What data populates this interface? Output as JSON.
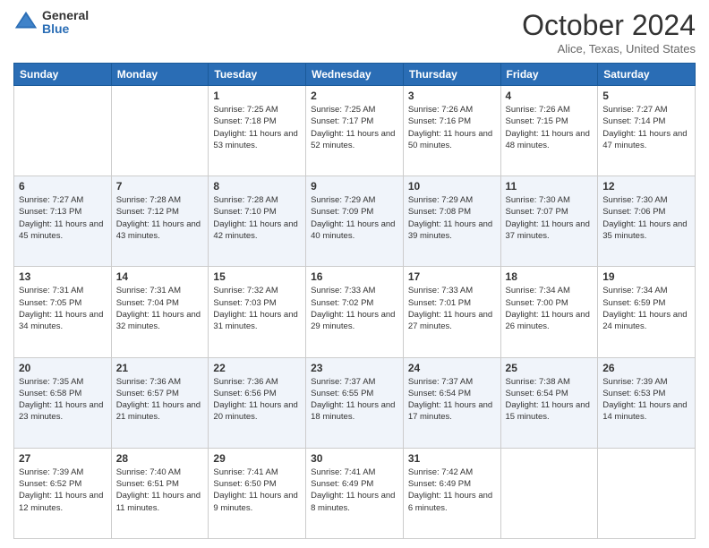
{
  "header": {
    "logo_general": "General",
    "logo_blue": "Blue",
    "month_title": "October 2024",
    "location": "Alice, Texas, United States"
  },
  "days_of_week": [
    "Sunday",
    "Monday",
    "Tuesday",
    "Wednesday",
    "Thursday",
    "Friday",
    "Saturday"
  ],
  "weeks": [
    [
      {
        "day": "",
        "sunrise": "",
        "sunset": "",
        "daylight": ""
      },
      {
        "day": "",
        "sunrise": "",
        "sunset": "",
        "daylight": ""
      },
      {
        "day": "1",
        "sunrise": "Sunrise: 7:25 AM",
        "sunset": "Sunset: 7:18 PM",
        "daylight": "Daylight: 11 hours and 53 minutes."
      },
      {
        "day": "2",
        "sunrise": "Sunrise: 7:25 AM",
        "sunset": "Sunset: 7:17 PM",
        "daylight": "Daylight: 11 hours and 52 minutes."
      },
      {
        "day": "3",
        "sunrise": "Sunrise: 7:26 AM",
        "sunset": "Sunset: 7:16 PM",
        "daylight": "Daylight: 11 hours and 50 minutes."
      },
      {
        "day": "4",
        "sunrise": "Sunrise: 7:26 AM",
        "sunset": "Sunset: 7:15 PM",
        "daylight": "Daylight: 11 hours and 48 minutes."
      },
      {
        "day": "5",
        "sunrise": "Sunrise: 7:27 AM",
        "sunset": "Sunset: 7:14 PM",
        "daylight": "Daylight: 11 hours and 47 minutes."
      }
    ],
    [
      {
        "day": "6",
        "sunrise": "Sunrise: 7:27 AM",
        "sunset": "Sunset: 7:13 PM",
        "daylight": "Daylight: 11 hours and 45 minutes."
      },
      {
        "day": "7",
        "sunrise": "Sunrise: 7:28 AM",
        "sunset": "Sunset: 7:12 PM",
        "daylight": "Daylight: 11 hours and 43 minutes."
      },
      {
        "day": "8",
        "sunrise": "Sunrise: 7:28 AM",
        "sunset": "Sunset: 7:10 PM",
        "daylight": "Daylight: 11 hours and 42 minutes."
      },
      {
        "day": "9",
        "sunrise": "Sunrise: 7:29 AM",
        "sunset": "Sunset: 7:09 PM",
        "daylight": "Daylight: 11 hours and 40 minutes."
      },
      {
        "day": "10",
        "sunrise": "Sunrise: 7:29 AM",
        "sunset": "Sunset: 7:08 PM",
        "daylight": "Daylight: 11 hours and 39 minutes."
      },
      {
        "day": "11",
        "sunrise": "Sunrise: 7:30 AM",
        "sunset": "Sunset: 7:07 PM",
        "daylight": "Daylight: 11 hours and 37 minutes."
      },
      {
        "day": "12",
        "sunrise": "Sunrise: 7:30 AM",
        "sunset": "Sunset: 7:06 PM",
        "daylight": "Daylight: 11 hours and 35 minutes."
      }
    ],
    [
      {
        "day": "13",
        "sunrise": "Sunrise: 7:31 AM",
        "sunset": "Sunset: 7:05 PM",
        "daylight": "Daylight: 11 hours and 34 minutes."
      },
      {
        "day": "14",
        "sunrise": "Sunrise: 7:31 AM",
        "sunset": "Sunset: 7:04 PM",
        "daylight": "Daylight: 11 hours and 32 minutes."
      },
      {
        "day": "15",
        "sunrise": "Sunrise: 7:32 AM",
        "sunset": "Sunset: 7:03 PM",
        "daylight": "Daylight: 11 hours and 31 minutes."
      },
      {
        "day": "16",
        "sunrise": "Sunrise: 7:33 AM",
        "sunset": "Sunset: 7:02 PM",
        "daylight": "Daylight: 11 hours and 29 minutes."
      },
      {
        "day": "17",
        "sunrise": "Sunrise: 7:33 AM",
        "sunset": "Sunset: 7:01 PM",
        "daylight": "Daylight: 11 hours and 27 minutes."
      },
      {
        "day": "18",
        "sunrise": "Sunrise: 7:34 AM",
        "sunset": "Sunset: 7:00 PM",
        "daylight": "Daylight: 11 hours and 26 minutes."
      },
      {
        "day": "19",
        "sunrise": "Sunrise: 7:34 AM",
        "sunset": "Sunset: 6:59 PM",
        "daylight": "Daylight: 11 hours and 24 minutes."
      }
    ],
    [
      {
        "day": "20",
        "sunrise": "Sunrise: 7:35 AM",
        "sunset": "Sunset: 6:58 PM",
        "daylight": "Daylight: 11 hours and 23 minutes."
      },
      {
        "day": "21",
        "sunrise": "Sunrise: 7:36 AM",
        "sunset": "Sunset: 6:57 PM",
        "daylight": "Daylight: 11 hours and 21 minutes."
      },
      {
        "day": "22",
        "sunrise": "Sunrise: 7:36 AM",
        "sunset": "Sunset: 6:56 PM",
        "daylight": "Daylight: 11 hours and 20 minutes."
      },
      {
        "day": "23",
        "sunrise": "Sunrise: 7:37 AM",
        "sunset": "Sunset: 6:55 PM",
        "daylight": "Daylight: 11 hours and 18 minutes."
      },
      {
        "day": "24",
        "sunrise": "Sunrise: 7:37 AM",
        "sunset": "Sunset: 6:54 PM",
        "daylight": "Daylight: 11 hours and 17 minutes."
      },
      {
        "day": "25",
        "sunrise": "Sunrise: 7:38 AM",
        "sunset": "Sunset: 6:54 PM",
        "daylight": "Daylight: 11 hours and 15 minutes."
      },
      {
        "day": "26",
        "sunrise": "Sunrise: 7:39 AM",
        "sunset": "Sunset: 6:53 PM",
        "daylight": "Daylight: 11 hours and 14 minutes."
      }
    ],
    [
      {
        "day": "27",
        "sunrise": "Sunrise: 7:39 AM",
        "sunset": "Sunset: 6:52 PM",
        "daylight": "Daylight: 11 hours and 12 minutes."
      },
      {
        "day": "28",
        "sunrise": "Sunrise: 7:40 AM",
        "sunset": "Sunset: 6:51 PM",
        "daylight": "Daylight: 11 hours and 11 minutes."
      },
      {
        "day": "29",
        "sunrise": "Sunrise: 7:41 AM",
        "sunset": "Sunset: 6:50 PM",
        "daylight": "Daylight: 11 hours and 9 minutes."
      },
      {
        "day": "30",
        "sunrise": "Sunrise: 7:41 AM",
        "sunset": "Sunset: 6:49 PM",
        "daylight": "Daylight: 11 hours and 8 minutes."
      },
      {
        "day": "31",
        "sunrise": "Sunrise: 7:42 AM",
        "sunset": "Sunset: 6:49 PM",
        "daylight": "Daylight: 11 hours and 6 minutes."
      },
      {
        "day": "",
        "sunrise": "",
        "sunset": "",
        "daylight": ""
      },
      {
        "day": "",
        "sunrise": "",
        "sunset": "",
        "daylight": ""
      }
    ]
  ]
}
